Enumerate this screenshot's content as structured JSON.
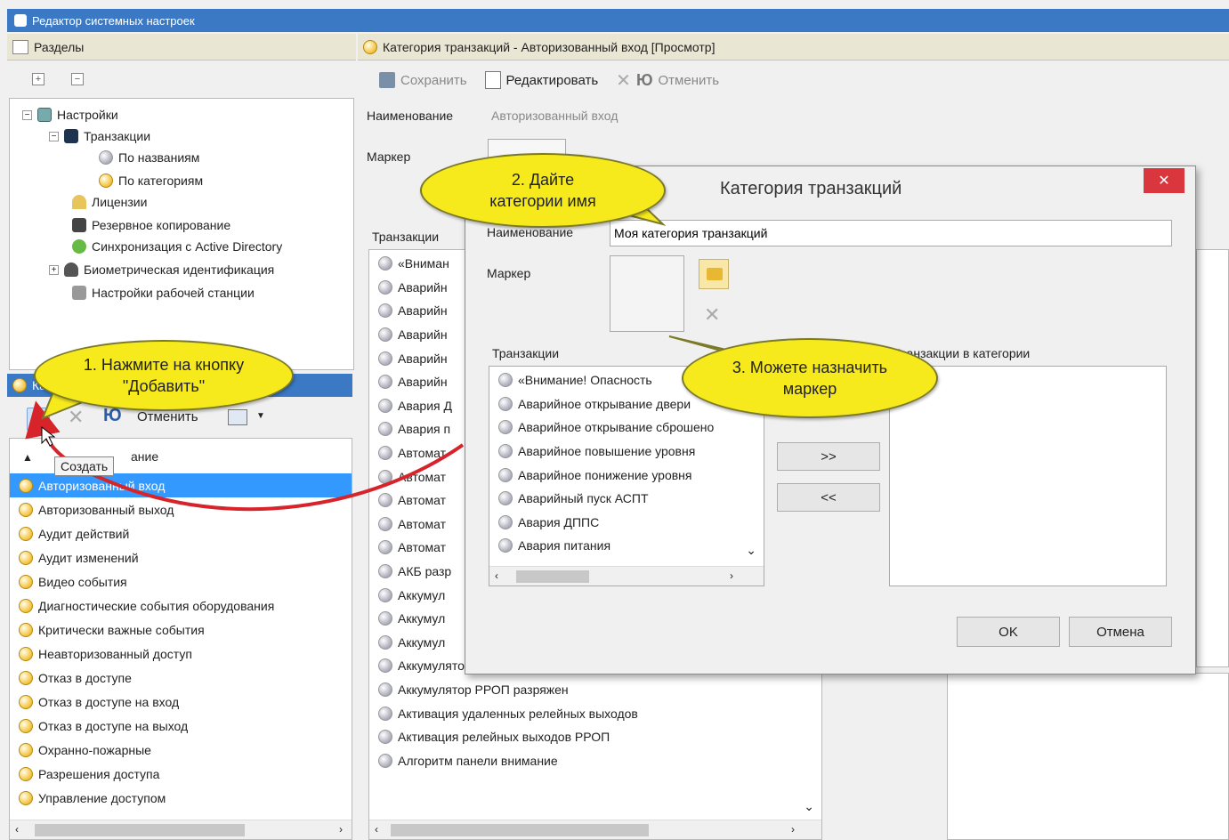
{
  "window": {
    "title": "Редактор системных настроек"
  },
  "left": {
    "header": "Разделы",
    "tree": [
      {
        "label": "Настройки",
        "level": 0,
        "icon": "settings-icon"
      },
      {
        "label": "Транзакции",
        "level": 1,
        "icon": "monitor-icon"
      },
      {
        "label": "По названиям",
        "level": 2,
        "icon": "circle-icon"
      },
      {
        "label": "По категориям",
        "level": 2,
        "icon": "category-icon"
      },
      {
        "label": "Лицензии",
        "level": 1,
        "icon": "license-icon"
      },
      {
        "label": "Резервное копирование",
        "level": 1,
        "icon": "backup-icon"
      },
      {
        "label": "Синхронизация с Active Directory",
        "level": 1,
        "icon": "sync-icon"
      },
      {
        "label": "Биометрическая идентификация",
        "level": 1,
        "icon": "person-icon"
      },
      {
        "label": "Настройки рабочей станции",
        "level": 1,
        "icon": "workstation-icon"
      }
    ],
    "categories_header": "Кат",
    "toolbar": {
      "cancel": "Отменить",
      "tooltip": "Создать"
    },
    "column_header": "ание",
    "categories": [
      "Авторизованный вход",
      "Авторизованный выход",
      "Аудит действий",
      "Аудит изменений",
      "Видео события",
      "Диагностические события оборудования",
      "Критически важные события",
      "Неавторизованный доступ",
      "Отказ в доступе",
      "Отказ в доступе на вход",
      "Отказ в доступе на выход",
      "Охранно-пожарные",
      "Разрешения доступа",
      "Управление доступом"
    ]
  },
  "right": {
    "header": "Категория транзакций - Авторизованный вход [Просмотр]",
    "toolbar": {
      "save": "Сохранить",
      "edit": "Редактировать",
      "cancel": "Отменить"
    },
    "name_label": "Наименование",
    "name_value": "Авторизованный вход",
    "marker_label": "Маркер",
    "transactions_label": "Транзакции",
    "transactions": [
      "«Вниман",
      "Аварийн",
      "Аварийн",
      "Аварийн",
      "Аварийн",
      "Аварийн",
      "Авария Д",
      "Авария п",
      "Автомат",
      "Автомат",
      "Автомат",
      "Автомат",
      "Автомат",
      "АКБ разр",
      "Аккумул",
      "Аккумул",
      "Аккумул",
      "Аккумулятор РРОП неисправен",
      "Аккумулятор РРОП разряжен",
      "Активация удаленных релейных выходов",
      "Активация релейных выходов РРОП",
      "Алгоритм панели внимание"
    ]
  },
  "dialog": {
    "title": "Категория транзакций",
    "name_label": "Наименование",
    "name_value": "Моя категория транзакций",
    "marker_label": "Маркер",
    "transactions_label": "Транзакции",
    "in_category_label": "Транзакции в категории",
    "transactions": [
      "«Внимание! Опасность",
      "Аварийное открывание двери",
      "Аварийное открывание сброшено",
      "Аварийное повышение уровня",
      "Аварийное понижение уровня",
      "Аварийный пуск АСПТ",
      "Авария ДППС",
      "Авария питания"
    ],
    "add_button": ">>",
    "remove_button": "<<",
    "ok": "OK",
    "cancel": "Отмена"
  },
  "callouts": {
    "step1": "1. Нажмите на кнопку \"Добавить\"",
    "step2": "2. Дайте категории имя",
    "step3": "3. Можете назначить маркер"
  },
  "colors": {
    "callout": "#f7ea1c",
    "selection": "#3399ff",
    "titlebar": "#3b79c4",
    "arrow": "#d6242a"
  }
}
